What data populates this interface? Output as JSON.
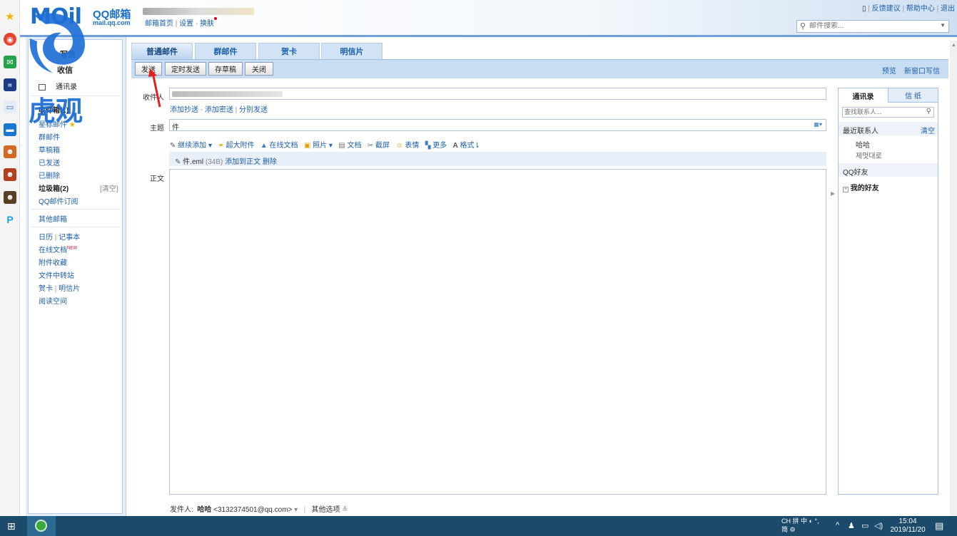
{
  "header": {
    "logo_text": "MOil",
    "brand": "QQ邮箱",
    "domain": "mail.qq.com",
    "links": [
      "邮箱首页",
      "设置",
      "换肤"
    ],
    "top_links": [
      "反馈建议",
      "帮助中心",
      "退出"
    ],
    "search_placeholder": "邮件搜索..."
  },
  "left_nav": {
    "compose": "写信",
    "inbox": "收信",
    "contacts": "通讯录",
    "inbox_count": "收件箱(1)",
    "starred": "星标邮件",
    "group_mail": "群邮件",
    "drafts": "草稿箱",
    "sent": "已发送",
    "deleted": "已删除",
    "spam": "垃圾箱(2)",
    "spam_clear": "[清空]",
    "subscription": "QQ邮件订阅",
    "other_mailbox": "其他邮箱",
    "calendar": "日历",
    "notebook": "记事本",
    "online_docs": "在线文档",
    "new_badge": "NEW",
    "attachments": "附件收藏",
    "file_transfer": "文件中转站",
    "greeting_card": "贺卡",
    "postcard": "明信片",
    "reading_space": "阅读空间"
  },
  "tabs": [
    "普通邮件",
    "群邮件",
    "贺卡",
    "明信片"
  ],
  "toolbar": {
    "send": "发送",
    "scheduled_send": "定时发送",
    "save_draft": "存草稿",
    "close": "关闭",
    "preview": "预览",
    "new_window": "新窗口写信"
  },
  "compose": {
    "recipient_label": "收件人",
    "add_cc": "添加抄送",
    "add_bcc": "添加密送",
    "separate_send": "分别发送",
    "subject_label": "主题",
    "subject_value": "件",
    "body_label": "正文",
    "attach_tools": [
      "继续添加",
      "超大附件",
      "在线文档",
      "照片",
      "文档",
      "截屏",
      "表情",
      "更多",
      "格式"
    ],
    "attachment_name": "件.eml",
    "attachment_size": "(34B)",
    "attachment_add_to_body": "添加到正文",
    "attachment_delete": "删除",
    "sender_label": "发件人:",
    "sender_name": "哈哈",
    "sender_email": "<3132374501@qq.com>",
    "other_options": "其他选项"
  },
  "contacts_panel": {
    "tab_contacts": "通讯录",
    "tab_stationery": "信 纸",
    "search_placeholder": "查找联系人...",
    "recent_title": "最近联系人",
    "recent_clear": "清空",
    "recent": [
      "哈哈",
      "제멋대로"
    ],
    "qq_friends_title": "QQ好友",
    "my_friends": "我的好友"
  },
  "watermark": "虎观",
  "taskbar": {
    "ime": "CH",
    "ime_mode": "中",
    "ime_simplified": "简",
    "time": "15:04",
    "date": "2019/11/20"
  }
}
